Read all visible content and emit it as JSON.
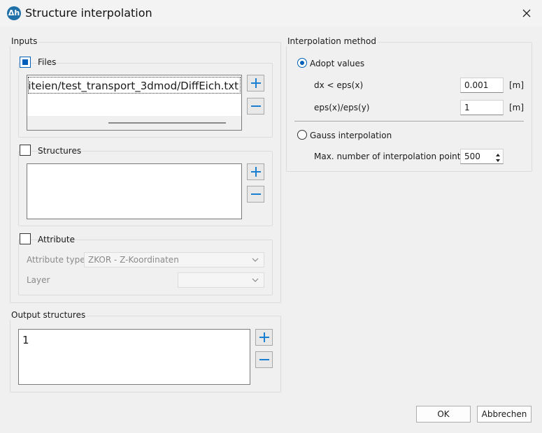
{
  "window": {
    "title": "Structure interpolation",
    "icon": "app-logo-icon"
  },
  "inputs": {
    "label": "Inputs",
    "files": {
      "label": "Files",
      "checked": true,
      "items": [
        "iteien/test_transport_3dmod/DiffEich.txt"
      ]
    },
    "structures": {
      "label": "Structures",
      "checked": false
    },
    "attribute": {
      "label": "Attribute",
      "checked": false,
      "type_label": "Attribute type",
      "type_value": "ZKOR - Z-Koordinaten",
      "layer_label": "Layer",
      "layer_value": ""
    }
  },
  "output": {
    "label": "Output structures",
    "items": [
      "1"
    ]
  },
  "method": {
    "label": "Interpolation method",
    "adopt": {
      "label": "Adopt values",
      "selected": true
    },
    "dx_label": "dx < eps(x)",
    "dx_value": "0.001",
    "dx_unit": "[m]",
    "ratio_label": "eps(x)/eps(y)",
    "ratio_value": "1",
    "ratio_unit": "[m]",
    "gauss": {
      "label": "Gauss interpolation",
      "selected": false
    },
    "maxpoints_label": "Max. number of interpolation points",
    "maxpoints_value": "500"
  },
  "buttons": {
    "ok": "OK",
    "cancel": "Abbrechen"
  },
  "colors": {
    "accent": "#005fb8",
    "add": "#1a7fd1"
  }
}
